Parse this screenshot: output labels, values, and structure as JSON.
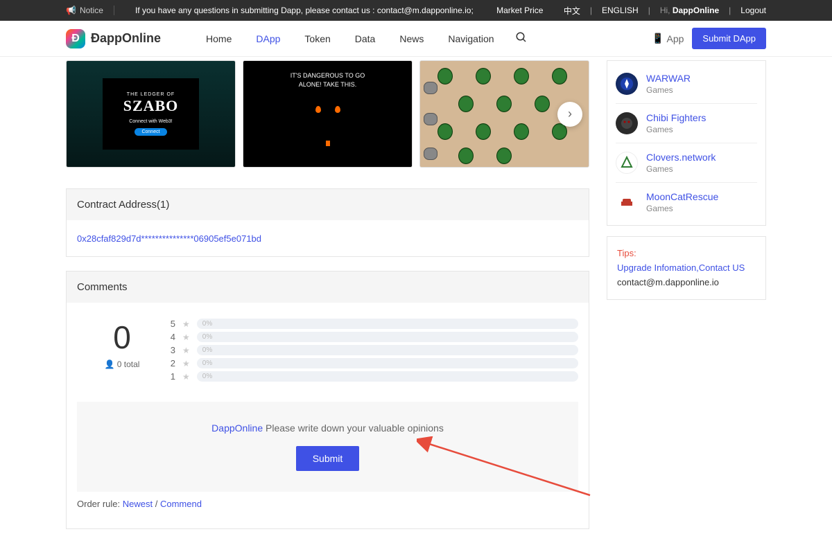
{
  "topbar": {
    "notice": "Notice",
    "scroll1": "If you have any questions in submitting Dapp, please contact us : contact@m.dapponline.io;",
    "scroll2": "Market Price",
    "lang_cn": "中文",
    "lang_en": "ENGLISH",
    "greeting_prefix": "Hi, ",
    "username": "DappOnline",
    "logout": "Logout"
  },
  "nav": {
    "brand": "ÐappOnline",
    "home": "Home",
    "dapp": "DApp",
    "token": "Token",
    "data": "Data",
    "news": "News",
    "navigation": "Navigation",
    "app": "App",
    "submit": "Submit DApp"
  },
  "carousel": {
    "szabo_top": "THE LEDGER OF",
    "szabo_title": "SZABO",
    "szabo_sub": "Connect with Web3!",
    "szabo_btn": "Connect",
    "dark2_line1": "IT'S DANGEROUS TO GO",
    "dark2_line2": "ALONE! TAKE THIS."
  },
  "contract": {
    "header": "Contract Address(1)",
    "address": "0x28cfaf829d7d***************06905ef5e071bd"
  },
  "comments": {
    "header": "Comments",
    "score": "0",
    "total": "0 total",
    "rows": [
      {
        "n": "5",
        "pct": "0%"
      },
      {
        "n": "4",
        "pct": "0%"
      },
      {
        "n": "3",
        "pct": "0%"
      },
      {
        "n": "2",
        "pct": "0%"
      },
      {
        "n": "1",
        "pct": "0%"
      }
    ],
    "prompt_user": "DappOnline",
    "prompt_text": " Please write down your valuable opinions",
    "submit": "Submit",
    "order_label": "Order rule: ",
    "order_newest": "Newest",
    "order_sep": " / ",
    "order_commend": "Commend"
  },
  "sidebar": {
    "items": [
      {
        "name": "WARWAR",
        "cat": "Games"
      },
      {
        "name": "Chibi Fighters",
        "cat": "Games"
      },
      {
        "name": "Clovers.network",
        "cat": "Games"
      },
      {
        "name": "MoonCatRescue",
        "cat": "Games"
      }
    ],
    "tips_label": "Tips:",
    "tips_link": "Upgrade Infomation,Contact US",
    "tips_email": "contact@m.dapponline.io"
  }
}
